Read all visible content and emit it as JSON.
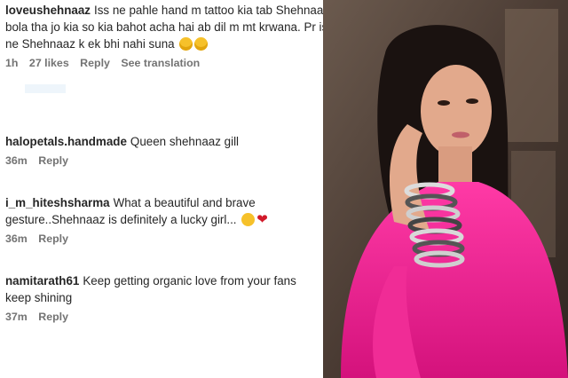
{
  "comments": [
    {
      "user": "loveushehnaaz",
      "line1": "Iss ne pahle hand m tattoo kia tab Shehnaaz ne",
      "line2": "bola tha jo kia so kia bahot acha hai ab dil m mt krwana. Pr iss",
      "line3": "ne Shehnaaz k ek bhi nahi suna",
      "time": "1h",
      "likes": "27 likes",
      "reply": "Reply",
      "translate": "See translation"
    },
    {
      "user": "halopetals.handmade",
      "line1": "Queen shehnaaz gill",
      "time": "36m",
      "reply": "Reply"
    },
    {
      "user": "i_m_hiteshsharma",
      "line1": "What a beautiful and brave",
      "line2": "gesture..Shehnaaz is definitely a lucky girl...",
      "time": "36m",
      "reply": "Reply"
    },
    {
      "user": "namitarath61",
      "line1": "Keep getting organic love from your fans",
      "line2": "keep shining",
      "time": "37m",
      "reply": "Reply"
    }
  ],
  "icons": {
    "laugh": "grinning-squinting-face-emoji",
    "starry": "star-struck-emoji",
    "heart": "red-heart-emoji"
  },
  "colors": {
    "pink_outfit": "#e8208f",
    "background_dark": "#4a3b33"
  }
}
